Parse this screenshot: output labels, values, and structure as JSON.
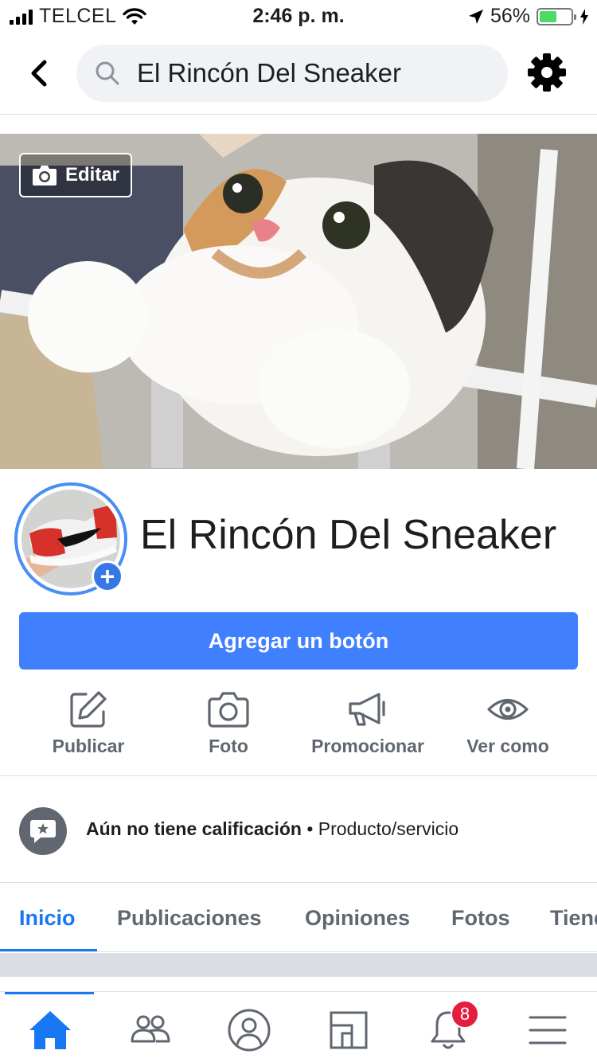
{
  "status_bar": {
    "carrier": "TELCEL",
    "time": "2:46 p. m.",
    "battery_percent": "56%",
    "battery_level": 0.56
  },
  "header": {
    "search_query": "El Rincón Del Sneaker",
    "icons": [
      "back-icon",
      "search-icon",
      "gear-icon"
    ]
  },
  "cover": {
    "edit_label": "Editar"
  },
  "profile": {
    "page_name": "El Rincón Del Sneaker",
    "add_icon": "+"
  },
  "cta": {
    "label": "Agregar un botón"
  },
  "actions": [
    {
      "label": "Publicar",
      "icon": "pencil-icon"
    },
    {
      "label": "Foto",
      "icon": "camera-icon"
    },
    {
      "label": "Promocionar",
      "icon": "megaphone-icon"
    },
    {
      "label": "Ver como",
      "icon": "eye-icon"
    }
  ],
  "rating": {
    "status": "Aún no tiene calificación",
    "separator": "•",
    "category": "Producto/servicio"
  },
  "tabs": [
    {
      "label": "Inicio",
      "active": true
    },
    {
      "label": "Publicaciones",
      "active": false
    },
    {
      "label": "Opiniones",
      "active": false
    },
    {
      "label": "Fotos",
      "active": false
    },
    {
      "label": "Tienda",
      "active": false
    }
  ],
  "bottom_nav": {
    "items": [
      "home-icon",
      "friends-icon",
      "profile-icon",
      "pages-icon",
      "notifications-icon",
      "menu-icon"
    ],
    "notifications_badge": "8"
  },
  "colors": {
    "accent": "#1877f2",
    "button_blue": "#4080ff",
    "badge_red": "#e41e3f",
    "battery_green": "#4cd964"
  }
}
